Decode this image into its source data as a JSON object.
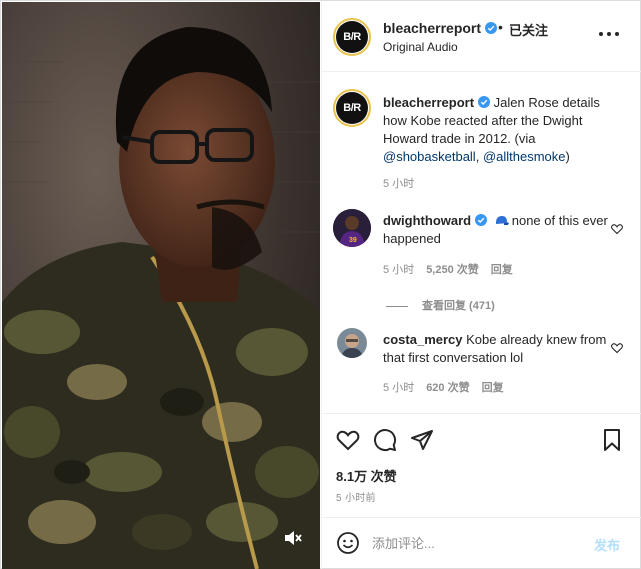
{
  "post": {
    "username": "bleacherreport",
    "verified": true,
    "follow_separator": "•",
    "follow_state": "已关注",
    "audio": "Original Audio",
    "avatar_text": "B/R",
    "avatar_icon": "bleacher-report-logo"
  },
  "caption": {
    "username": "bleacherreport",
    "text": "Jalen Rose details how Kobe reacted after the Dwight Howard trade in 2012. (via ",
    "mention1": "@shobasketball",
    "sep": ", ",
    "mention2": "@allthesmoke",
    "tail": ")",
    "time": "5 小时"
  },
  "comments": [
    {
      "username": "dwighthoward",
      "verified": true,
      "emoji": "blue-cap-emoji",
      "text": "none of this ever happened",
      "time": "5 小时",
      "likes": "5,250 次赞",
      "reply": "回复",
      "view_replies": "查看回复 (471)"
    },
    {
      "username": "costa_mercy",
      "text": "Kobe already knew from that first conversation lol",
      "time": "5 小时",
      "likes": "620 次赞",
      "reply": "回复"
    }
  ],
  "actions": {
    "like_icon": "heart-icon",
    "comment_icon": "comment-icon",
    "share_icon": "paper-plane-icon",
    "save_icon": "bookmark-icon",
    "likes_total": "8.1万 次赞",
    "post_time": "5 小时前"
  },
  "composer": {
    "placeholder": "添加评论...",
    "post_label": "发布",
    "emoji_icon": "emoji-smile-icon"
  },
  "video": {
    "mute_icon": "speaker-muted-icon"
  },
  "colors": {
    "text": "#262626",
    "secondary": "#8e8e8e",
    "verified_blue": "#3897f0",
    "mention_blue": "#00376b",
    "post_disabled": "#b2dffc",
    "camo_dark": "#2c2a1e",
    "camo_olive": "#5a5a38"
  }
}
